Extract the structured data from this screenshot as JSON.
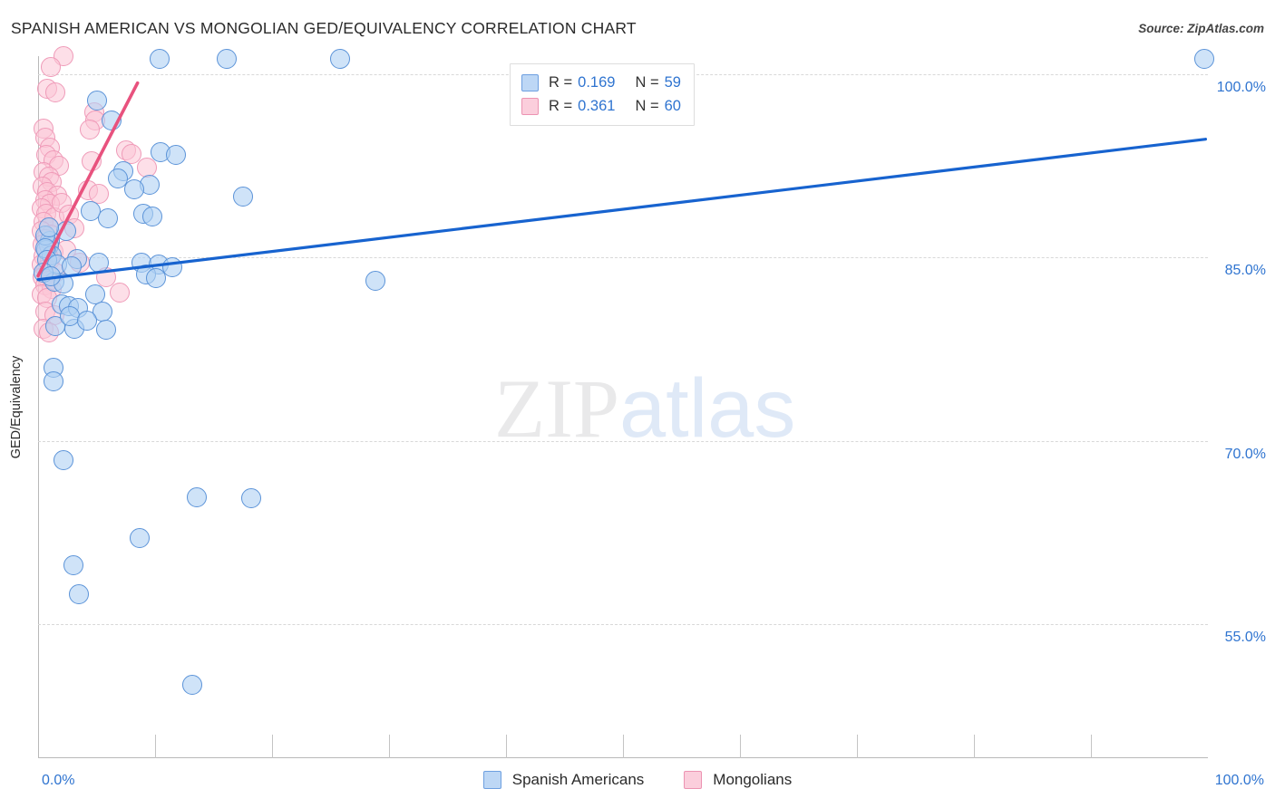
{
  "header": {
    "title": "SPANISH AMERICAN VS MONGOLIAN GED/EQUIVALENCY CORRELATION CHART",
    "source": "Source: ZipAtlas.com"
  },
  "watermark": {
    "zip": "ZIP",
    "atlas": "atlas"
  },
  "stats_legend": {
    "rows": [
      {
        "color": "blue",
        "r_label": "R =",
        "r_value": "0.169",
        "n_label": "N =",
        "n_value": "59"
      },
      {
        "color": "pink",
        "r_label": "R =",
        "r_value": "0.361",
        "n_label": "N =",
        "n_value": "60"
      }
    ]
  },
  "bottom_legend": {
    "items": [
      {
        "label": "Spanish Americans",
        "color": "#bdd7f5"
      },
      {
        "label": "Mongolians",
        "color": "#fbcedc"
      }
    ]
  },
  "chart_data": {
    "type": "scatter",
    "title": "SPANISH AMERICAN VS MONGOLIAN GED/EQUIVALENCY CORRELATION CHART",
    "xlabel": "",
    "ylabel": "GED/Equivalency",
    "xlim": [
      0,
      100
    ],
    "ylim": [
      44.0,
      101.5
    ],
    "grid": true,
    "legend_position": "bottom-center",
    "x_ticks": [
      "0.0%",
      "100.0%"
    ],
    "x_tick_values": [
      0,
      100
    ],
    "y_ticks": [
      "100.0%",
      "85.0%",
      "70.0%",
      "55.0%"
    ],
    "y_tick_values": [
      100.0,
      85.0,
      70.0,
      55.0
    ],
    "series": [
      {
        "name": "Spanish Americans",
        "color": "#bdd7f5",
        "edge_color": "#5b93d8",
        "r": 0.169,
        "n": 59,
        "trendline": {
          "x0": 0.0,
          "y0": 83.2,
          "x1": 99.8,
          "y1": 94.7,
          "color": "#1763cf"
        },
        "points": [
          [
            10.4,
            101.3
          ],
          [
            16.1,
            101.3
          ],
          [
            25.8,
            101.3
          ],
          [
            99.7,
            101.3
          ],
          [
            5.0,
            97.9
          ],
          [
            6.3,
            96.2
          ],
          [
            10.5,
            93.6
          ],
          [
            11.8,
            93.4
          ],
          [
            7.3,
            92.1
          ],
          [
            6.8,
            91.5
          ],
          [
            9.5,
            91.0
          ],
          [
            8.2,
            90.6
          ],
          [
            17.5,
            90.0
          ],
          [
            4.5,
            88.8
          ],
          [
            6.0,
            88.2
          ],
          [
            9.0,
            88.6
          ],
          [
            9.8,
            88.4
          ],
          [
            2.4,
            87.2
          ],
          [
            1.0,
            86.4
          ],
          [
            0.9,
            86.0
          ],
          [
            0.7,
            85.6
          ],
          [
            1.2,
            85.2
          ],
          [
            3.3,
            84.9
          ],
          [
            5.2,
            84.6
          ],
          [
            8.8,
            84.6
          ],
          [
            10.3,
            84.4
          ],
          [
            11.5,
            84.2
          ],
          [
            9.2,
            83.6
          ],
          [
            10.1,
            83.3
          ],
          [
            1.4,
            83.0
          ],
          [
            2.2,
            82.9
          ],
          [
            28.8,
            83.1
          ],
          [
            4.9,
            82.0
          ],
          [
            2.0,
            81.2
          ],
          [
            2.6,
            81.0
          ],
          [
            3.4,
            80.9
          ],
          [
            5.5,
            80.6
          ],
          [
            1.5,
            79.4
          ],
          [
            3.1,
            79.2
          ],
          [
            5.8,
            79.1
          ],
          [
            1.3,
            76.0
          ],
          [
            1.3,
            74.9
          ],
          [
            2.2,
            68.4
          ],
          [
            13.6,
            65.4
          ],
          [
            18.2,
            65.3
          ],
          [
            8.7,
            62.0
          ],
          [
            3.0,
            59.8
          ],
          [
            3.5,
            57.4
          ],
          [
            13.2,
            50.0
          ],
          [
            0.6,
            86.8
          ],
          [
            0.6,
            85.8
          ],
          [
            0.8,
            84.8
          ],
          [
            1.6,
            84.4
          ],
          [
            2.9,
            84.3
          ],
          [
            0.5,
            83.8
          ],
          [
            1.1,
            83.5
          ],
          [
            2.7,
            80.2
          ],
          [
            4.2,
            79.8
          ],
          [
            0.9,
            87.5
          ]
        ]
      },
      {
        "name": "Mongolians",
        "color": "#fbcedc",
        "edge_color": "#ef9ab8",
        "r": 0.361,
        "n": 60,
        "trendline": {
          "x0": 0.0,
          "y0": 83.5,
          "x1": 8.5,
          "y1": 99.3,
          "color": "#e8527e"
        },
        "points": [
          [
            2.2,
            101.5
          ],
          [
            1.1,
            100.6
          ],
          [
            0.8,
            98.8
          ],
          [
            1.5,
            98.5
          ],
          [
            4.8,
            96.9
          ],
          [
            4.9,
            96.2
          ],
          [
            4.4,
            95.5
          ],
          [
            0.5,
            95.6
          ],
          [
            0.6,
            94.8
          ],
          [
            1.0,
            94.0
          ],
          [
            0.7,
            93.4
          ],
          [
            1.3,
            93.0
          ],
          [
            1.8,
            92.5
          ],
          [
            0.5,
            92.0
          ],
          [
            0.9,
            91.6
          ],
          [
            1.2,
            91.2
          ],
          [
            0.4,
            90.8
          ],
          [
            0.8,
            90.4
          ],
          [
            1.6,
            90.1
          ],
          [
            0.6,
            89.7
          ],
          [
            1.0,
            89.4
          ],
          [
            0.3,
            89.0
          ],
          [
            0.7,
            88.6
          ],
          [
            1.4,
            88.3
          ],
          [
            0.5,
            87.9
          ],
          [
            0.9,
            87.5
          ],
          [
            0.3,
            87.2
          ],
          [
            1.1,
            86.9
          ],
          [
            0.6,
            86.5
          ],
          [
            0.4,
            86.1
          ],
          [
            0.8,
            85.8
          ],
          [
            1.3,
            85.5
          ],
          [
            0.5,
            85.1
          ],
          [
            1.0,
            84.8
          ],
          [
            0.3,
            84.4
          ],
          [
            0.7,
            84.1
          ],
          [
            1.5,
            83.8
          ],
          [
            0.4,
            83.4
          ],
          [
            0.9,
            83.1
          ],
          [
            0.6,
            82.7
          ],
          [
            1.2,
            82.4
          ],
          [
            0.3,
            82.0
          ],
          [
            0.8,
            81.7
          ],
          [
            2.0,
            89.5
          ],
          [
            2.6,
            88.5
          ],
          [
            3.1,
            87.4
          ],
          [
            2.4,
            85.6
          ],
          [
            3.6,
            84.6
          ],
          [
            4.3,
            90.5
          ],
          [
            5.2,
            90.2
          ],
          [
            7.5,
            93.8
          ],
          [
            8.0,
            93.5
          ],
          [
            9.3,
            92.4
          ],
          [
            5.8,
            83.4
          ],
          [
            7.0,
            82.1
          ],
          [
            0.6,
            80.6
          ],
          [
            1.4,
            80.3
          ],
          [
            0.5,
            79.2
          ],
          [
            0.9,
            78.9
          ],
          [
            4.6,
            92.9
          ]
        ]
      }
    ]
  }
}
